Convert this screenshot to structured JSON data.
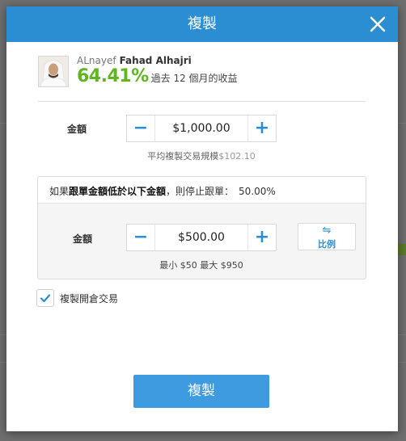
{
  "modal": {
    "title": "複製"
  },
  "trader": {
    "first_name": "ALnayef",
    "last_name": "Fahad Alhajri",
    "gain": "64.41%",
    "gain_desc": "過去 12 個月的收益"
  },
  "amount": {
    "label": "金額",
    "value": "$1,000.00",
    "avg_label": "平均複製交易規模",
    "avg_value": "$102.10"
  },
  "stop_loss": {
    "text_prefix": "如果",
    "text_bold": "跟單金額低於以下金額",
    "text_suffix": "，則停止跟單：",
    "percent": "50.00%",
    "label": "金額",
    "value": "$500.00",
    "range": "最小 $50 最大 $950",
    "ratio_label": "比例",
    "ratio_icon": "swap-arrows-icon"
  },
  "open_trades": {
    "label": "複製開倉交易",
    "checked": true
  },
  "submit": {
    "label": "複製"
  },
  "colors": {
    "header": "#2b8ed3",
    "accent": "#2b8ed3",
    "gain": "#5fb61f",
    "button": "#3f9be0"
  }
}
